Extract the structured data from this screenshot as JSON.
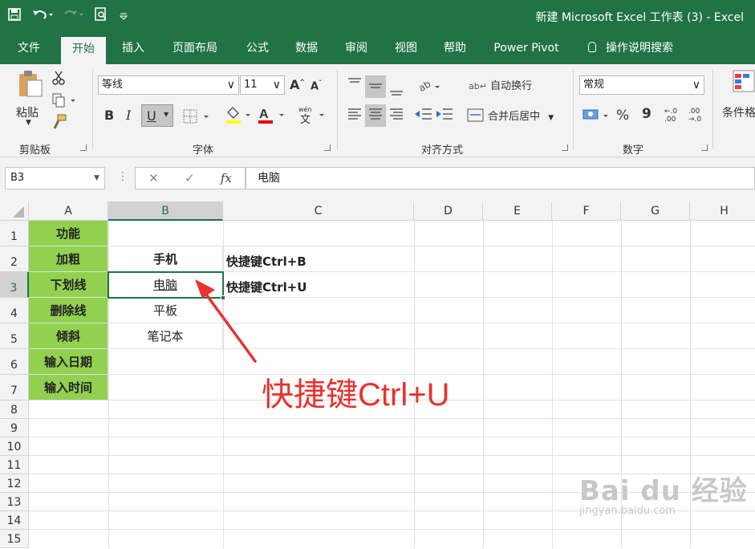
{
  "window": {
    "title": "新建 Microsoft Excel 工作表 (3)  -  Excel"
  },
  "quick_access": [
    "save-icon",
    "undo-icon",
    "redo-icon",
    "print-preview-icon",
    "customize-qat-icon"
  ],
  "tabs": [
    {
      "label": "文件",
      "active": false
    },
    {
      "label": "开始",
      "active": true
    },
    {
      "label": "插入",
      "active": false
    },
    {
      "label": "页面布局",
      "active": false
    },
    {
      "label": "公式",
      "active": false
    },
    {
      "label": "数据",
      "active": false
    },
    {
      "label": "审阅",
      "active": false
    },
    {
      "label": "视图",
      "active": false
    },
    {
      "label": "帮助",
      "active": false
    },
    {
      "label": "Power Pivot",
      "active": false
    }
  ],
  "tell_me": "操作说明搜索",
  "ribbon": {
    "clipboard": {
      "paste": "粘贴",
      "label": "剪贴板"
    },
    "font": {
      "name": "等线",
      "size": "11",
      "bold": "B",
      "italic": "I",
      "underline": "U",
      "label": "字体"
    },
    "alignment": {
      "wrap": "自动换行",
      "merge": "合并后居中",
      "label": "对齐方式"
    },
    "number": {
      "format": "常规",
      "percent": "%",
      "comma": "9",
      "label": "数字"
    },
    "styles": {
      "conditional": "条件格"
    }
  },
  "formula_bar": {
    "name_box": "B3",
    "fx": "fx",
    "value": "电脑"
  },
  "sheet": {
    "columns": [
      "A",
      "B",
      "C",
      "D",
      "E",
      "F",
      "G",
      "H"
    ],
    "rows": [
      "1",
      "2",
      "3",
      "4",
      "5",
      "6",
      "7",
      "8",
      "9",
      "10",
      "11",
      "12",
      "13",
      "14",
      "15"
    ],
    "col_a": [
      "功能",
      "加粗",
      "下划线",
      "删除线",
      "倾斜",
      "输入日期",
      "输入时间"
    ],
    "col_b": [
      "",
      "手机",
      "电脑",
      "平板",
      "笔记本"
    ],
    "col_c": [
      "",
      "快捷键Ctrl+B",
      "快捷键Ctrl+U"
    ],
    "selected_cell": "B3",
    "fill_color": "#92d050"
  },
  "annotation": "快捷键Ctrl+U",
  "watermark": {
    "line1": "Bai du 经验",
    "line2": "jingyan.baidu.com"
  }
}
